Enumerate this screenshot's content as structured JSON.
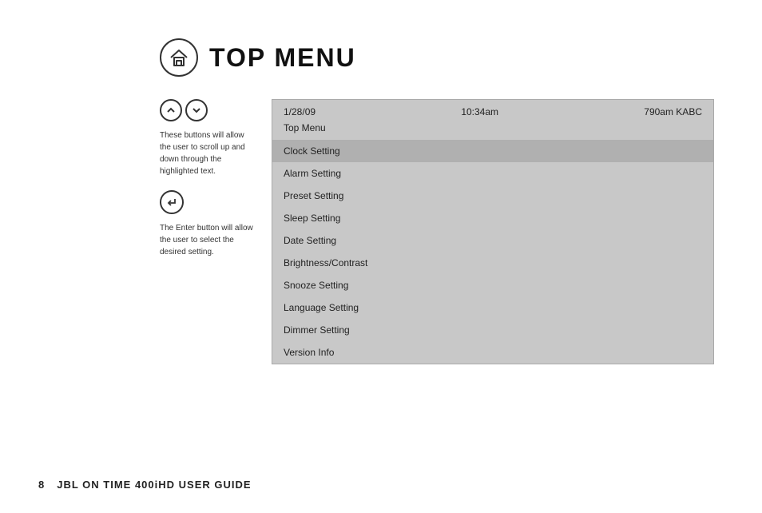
{
  "footer": {
    "page_number": "8",
    "title": "JBL ON TIME 400iHD USER GUIDE"
  },
  "header": {
    "title": "TOP MENU"
  },
  "instructions": {
    "nav_up_symbol": "∧",
    "nav_down_symbol": "∨",
    "nav_text": "These buttons will allow the user to scroll up and down through the highlighted text.",
    "enter_text": "The Enter button will allow the user to select the desired setting."
  },
  "screen": {
    "date": "1/28/09",
    "time": "10:34am",
    "station": "790am KABC",
    "menu_label": "Top Menu",
    "menu_items": [
      {
        "label": "Clock Setting",
        "selected": true
      },
      {
        "label": "Alarm Setting",
        "selected": false
      },
      {
        "label": "Preset Setting",
        "selected": false
      },
      {
        "label": "Sleep Setting",
        "selected": false
      },
      {
        "label": "Date Setting",
        "selected": false
      },
      {
        "label": "Brightness/Contrast",
        "selected": false
      },
      {
        "label": "Snooze Setting",
        "selected": false
      },
      {
        "label": "Language Setting",
        "selected": false
      },
      {
        "label": "Dimmer Setting",
        "selected": false
      },
      {
        "label": "Version Info",
        "selected": false
      }
    ]
  }
}
